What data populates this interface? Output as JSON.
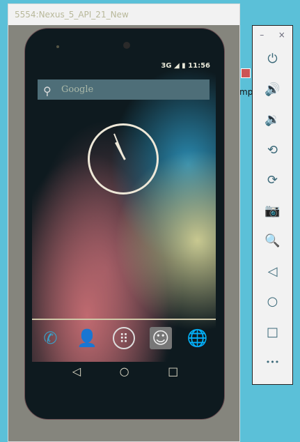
{
  "window": {
    "title": "5554:Nexus_5_API_21_New"
  },
  "status": {
    "network": "3G",
    "time": "11:56"
  },
  "search": {
    "placeholder": "Google"
  },
  "desktop": {
    "label": "mp."
  },
  "dock": [
    {
      "icon": "phone-icon",
      "glyph": "✆"
    },
    {
      "icon": "contacts-icon",
      "glyph": "👤"
    },
    {
      "icon": "app-drawer-icon",
      "glyph": "⠿"
    },
    {
      "icon": "messaging-icon",
      "glyph": "☺"
    },
    {
      "icon": "browser-icon",
      "glyph": "🌐"
    }
  ],
  "nav": {
    "back": "◁",
    "home": "○",
    "recents": "□"
  },
  "toolbar": {
    "minimize": "–",
    "close": "×",
    "buttons": [
      {
        "name": "power",
        "glyph": "⏻"
      },
      {
        "name": "volume-up",
        "glyph": "🔊"
      },
      {
        "name": "volume-down",
        "glyph": "🔉"
      },
      {
        "name": "rotate-left",
        "glyph": "⟲"
      },
      {
        "name": "rotate-right",
        "glyph": "⟳"
      },
      {
        "name": "screenshot",
        "glyph": "📷"
      },
      {
        "name": "zoom",
        "glyph": "🔍"
      },
      {
        "name": "back",
        "glyph": "◁"
      },
      {
        "name": "home",
        "glyph": "○"
      },
      {
        "name": "overview",
        "glyph": "□"
      },
      {
        "name": "more",
        "glyph": "•••"
      }
    ]
  }
}
